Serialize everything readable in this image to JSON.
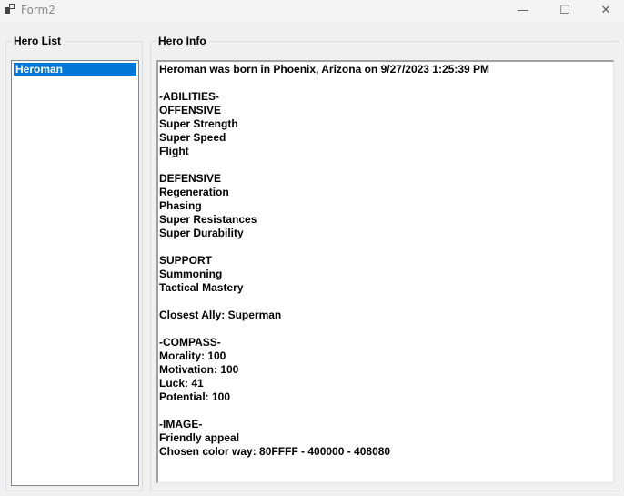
{
  "window": {
    "title": "Form2",
    "minimize_glyph": "—",
    "maximize_glyph": "☐",
    "close_glyph": "✕"
  },
  "hero_list": {
    "label": "Hero List",
    "items": [
      {
        "label": "Heroman",
        "selected": true
      }
    ]
  },
  "hero_info": {
    "label": "Hero Info",
    "lines": [
      "Heroman was born in Phoenix, Arizona on 9/27/2023 1:25:39 PM",
      "",
      "-ABILITIES-",
      "OFFENSIVE",
      "Super Strength",
      "Super Speed",
      "Flight",
      "",
      "DEFENSIVE",
      "Regeneration",
      "Phasing",
      "Super Resistances",
      "Super Durability",
      "",
      "SUPPORT",
      "Summoning",
      "Tactical Mastery",
      "",
      "Closest Ally: Superman",
      "",
      "-COMPASS-",
      "Morality: 100",
      "Motivation: 100",
      "Luck: 41",
      "Potential: 100",
      "",
      "-IMAGE-",
      "Friendly appeal",
      "Chosen color way: 80FFFF - 400000 - 408080"
    ]
  },
  "colors": {
    "selection": "#0078d7",
    "window_bg": "#f0f0f0"
  }
}
